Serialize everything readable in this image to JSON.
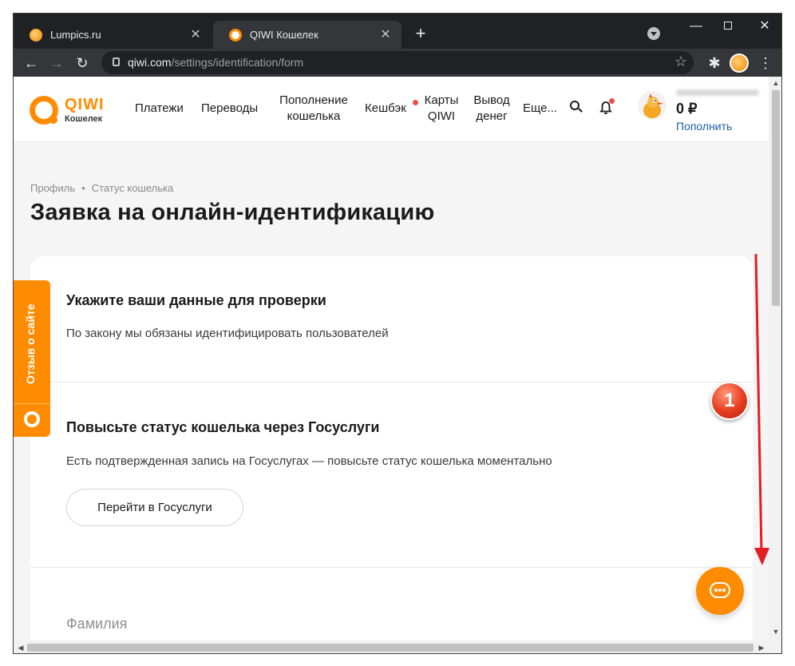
{
  "browser": {
    "tabs": [
      {
        "title": "Lumpics.ru",
        "close": "✕"
      },
      {
        "title": "QIWI Кошелек",
        "close": "✕"
      }
    ],
    "new_tab": "+",
    "window": {
      "minimize": "—",
      "close": "✕"
    },
    "url_host": "qiwi.com",
    "url_path": "/settings/identification/form",
    "back": "←",
    "forward": "→",
    "reload": "↻",
    "star": "☆",
    "extensions": "✱",
    "menu": "⋮"
  },
  "header": {
    "logo_word": "QIWI",
    "logo_sub": "Кошелек",
    "nav": {
      "payments": "Платежи",
      "transfers": "Переводы",
      "topup": "Пополнение кошелька",
      "cashback": "Кешбэк",
      "cards": "Карты QIWI",
      "withdraw": "Вывод денег",
      "more": "Еще..."
    },
    "balance": "0 ₽",
    "topup_link": "Пополнить"
  },
  "breadcrumb": {
    "profile": "Профиль",
    "sep": "•",
    "status": "Статус кошелька"
  },
  "page_title": "Заявка на онлайн-идентификацию",
  "form": {
    "section1_title": "Укажите ваши данные для проверки",
    "section1_text": "По закону мы обязаны идентифицировать пользователей",
    "section2_title": "Повысьте статус кошелька через Госуслуги",
    "section2_text": "Есть подтвержденная запись на Госуслугах — повысьте статус кошелька моментально",
    "gosuslugi_button": "Перейти в Госуслуги",
    "lastname_label": "Фамилия"
  },
  "feedback_tab": "Отзыв о сайте",
  "annotation": {
    "badge": "1",
    "arrow_color": "#e31e24"
  },
  "colors": {
    "accent": "#ff8c00",
    "link": "#1a5fa8",
    "dot": "#f04e4e"
  }
}
